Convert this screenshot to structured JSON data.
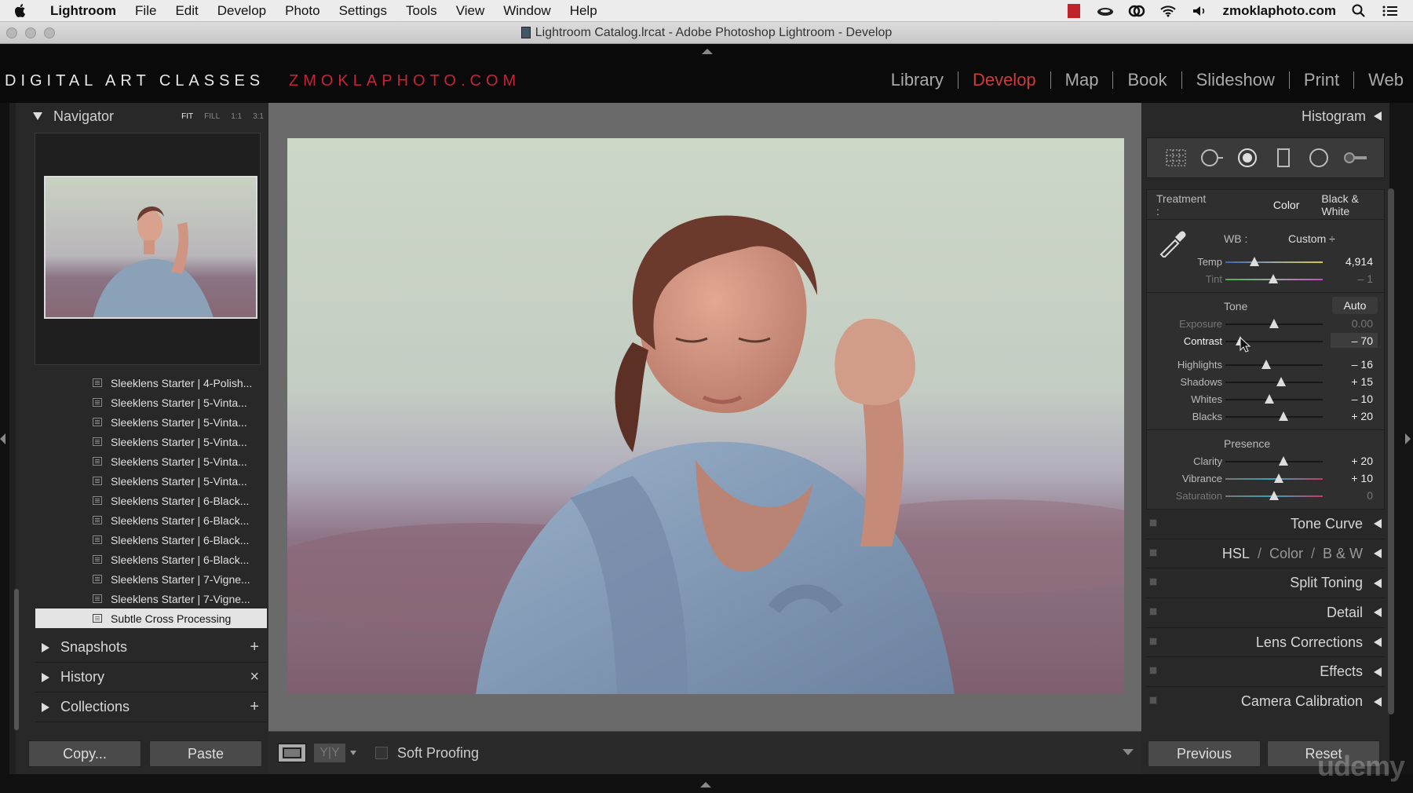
{
  "menubar": {
    "app": "Lightroom",
    "items": [
      "File",
      "Edit",
      "Develop",
      "Photo",
      "Settings",
      "Tools",
      "View",
      "Window",
      "Help"
    ],
    "site": "zmoklaphoto.com"
  },
  "titlebar": {
    "title": "Lightroom Catalog.lrcat - Adobe Photoshop Lightroom - Develop"
  },
  "identity": {
    "left": "DIGITAL ART CLASSES",
    "right": "ZMOKLAPHOTO.COM"
  },
  "modules": [
    "Library",
    "Develop",
    "Map",
    "Book",
    "Slideshow",
    "Print",
    "Web"
  ],
  "active_module": "Develop",
  "navigator": {
    "title": "Navigator",
    "zoom": [
      "FIT",
      "FILL",
      "1:1",
      "3:1"
    ]
  },
  "presets": [
    "Sleeklens Starter | 4-Polish...",
    "Sleeklens Starter | 5-Vinta...",
    "Sleeklens Starter | 5-Vinta...",
    "Sleeklens Starter | 5-Vinta...",
    "Sleeklens Starter | 5-Vinta...",
    "Sleeklens Starter | 5-Vinta...",
    "Sleeklens Starter | 6-Black...",
    "Sleeklens Starter | 6-Black...",
    "Sleeklens Starter | 6-Black...",
    "Sleeklens Starter | 6-Black...",
    "Sleeklens Starter | 7-Vigne...",
    "Sleeklens Starter | 7-Vigne...",
    "Subtle Cross Processing"
  ],
  "left_sections": [
    {
      "label": "Snapshots",
      "action": "+"
    },
    {
      "label": "History",
      "action": "×"
    },
    {
      "label": "Collections",
      "action": "+"
    }
  ],
  "left_buttons": {
    "copy": "Copy...",
    "paste": "Paste"
  },
  "toolbar": {
    "yy": "Y|Y",
    "soft_proofing": "Soft Proofing"
  },
  "right": {
    "histogram": "Histogram",
    "treatment_label": "Treatment :",
    "treatment_color": "Color",
    "treatment_bw": "Black & White",
    "wb_label": "WB :",
    "wb_value": "Custom ÷",
    "temp": {
      "label": "Temp",
      "value": "4,914",
      "position": 0.3
    },
    "tint": {
      "label": "Tint",
      "value": "– 1",
      "position": 0.49
    },
    "tone_title": "Tone",
    "auto": "Auto",
    "exposure": {
      "label": "Exposure",
      "value": "0.00",
      "position": 0.5
    },
    "contrast": {
      "label": "Contrast",
      "value": "– 70",
      "position": 0.15
    },
    "highlights": {
      "label": "Highlights",
      "value": "– 16",
      "position": 0.42
    },
    "shadows": {
      "label": "Shadows",
      "value": "+ 15",
      "position": 0.57
    },
    "whites": {
      "label": "Whites",
      "value": "– 10",
      "position": 0.45
    },
    "blacks": {
      "label": "Blacks",
      "value": "+ 20",
      "position": 0.6
    },
    "presence_title": "Presence",
    "clarity": {
      "label": "Clarity",
      "value": "+ 20",
      "position": 0.6
    },
    "vibrance": {
      "label": "Vibrance",
      "value": "+ 10",
      "position": 0.55
    },
    "saturation": {
      "label": "Saturation",
      "value": "0",
      "position": 0.5
    },
    "panels": {
      "tone_curve": "Tone Curve",
      "hsl": "HSL",
      "color": "Color",
      "bw": "B & W",
      "split_toning": "Split Toning",
      "detail": "Detail",
      "lens_corrections": "Lens Corrections",
      "effects": "Effects",
      "camera_calibration": "Camera Calibration"
    },
    "previous": "Previous",
    "reset": "Reset"
  },
  "watermark": "udemy",
  "colors": {
    "accent_red": "#d03a3a",
    "panel": "#282828"
  }
}
